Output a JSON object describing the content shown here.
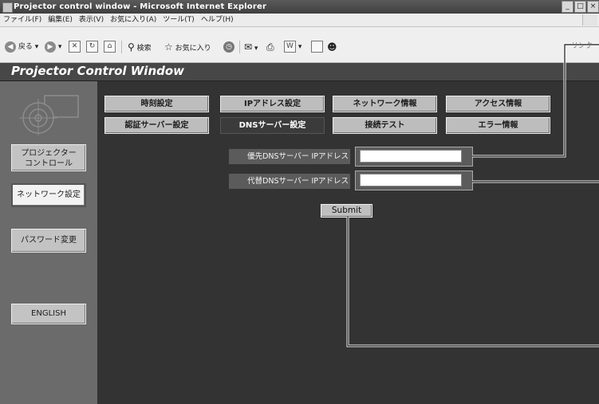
{
  "window": {
    "title": "Projector control window - Microsoft Internet Explorer",
    "buttons": [
      "_",
      "□",
      "×"
    ]
  },
  "menu": [
    "ファイル(F)",
    "編集(E)",
    "表示(V)",
    "お気に入り(A)",
    "ツール(T)",
    "ヘルプ(H)"
  ],
  "toolbar": {
    "back_label": "戻る",
    "search_label": "検索",
    "favorites_label": "お気に入り",
    "links_label": "リンク"
  },
  "app": {
    "title": "Projector Control Window"
  },
  "sidebar": {
    "items": [
      {
        "label": "プロジェクター\nコントロール"
      },
      {
        "label": "ネットワーク設定"
      },
      {
        "label": "パスワード変更"
      },
      {
        "label": "ENGLISH"
      }
    ]
  },
  "tabs": [
    {
      "label": "時刻設定"
    },
    {
      "label": "IPアドレス設定"
    },
    {
      "label": "ネットワーク情報"
    },
    {
      "label": "アクセス情報"
    },
    {
      "label": "認証サーバー設定"
    },
    {
      "label": "DNSサーバー設定"
    },
    {
      "label": "接続テスト"
    },
    {
      "label": "エラー情報"
    }
  ],
  "form": {
    "primary_dns_label": "優先DNSサーバー IPアドレス",
    "primary_dns_value": "",
    "secondary_dns_label": "代替DNSサーバー IPアドレス",
    "secondary_dns_value": "",
    "submit_label": "Submit"
  },
  "colors": {
    "header_bg": "#474747",
    "sidebar_bg": "#6b6b6b",
    "content_bg": "#333333",
    "active_tab_bg": "#3b3b3b"
  }
}
